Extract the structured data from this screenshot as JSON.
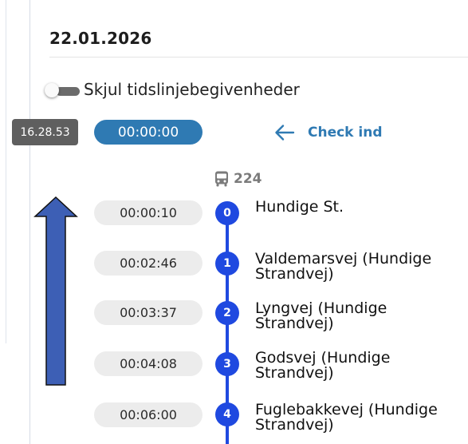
{
  "header": {
    "date": "22.01.2026"
  },
  "toggle": {
    "label": "Skjul tidslinjebegivenheder",
    "on": false
  },
  "clock": "16.28.53",
  "elapsed": "00:00:00",
  "checkin": {
    "label": "Check ind",
    "icon": "arrow-left-icon"
  },
  "route": {
    "icon": "bus-icon",
    "number": "224"
  },
  "annotation": {
    "icon": "arrow-up-icon",
    "color": "#3d5fb5"
  },
  "colors": {
    "accent": "#2f7ab3",
    "timeline": "#1f49e0",
    "badge": "#5f5f5f"
  },
  "stops": [
    {
      "index": "0",
      "time": "00:00:10",
      "name": "Hundige St."
    },
    {
      "index": "1",
      "time": "00:02:46",
      "name": "Valdemarsvej (Hundige Strandvej)"
    },
    {
      "index": "2",
      "time": "00:03:37",
      "name": "Lyngvej (Hundige Strandvej)"
    },
    {
      "index": "3",
      "time": "00:04:08",
      "name": "Godsvej (Hundige Strandvej)"
    },
    {
      "index": "4",
      "time": "00:06:00",
      "name": "Fuglebakkevej (Hundige Strandvej)"
    }
  ]
}
